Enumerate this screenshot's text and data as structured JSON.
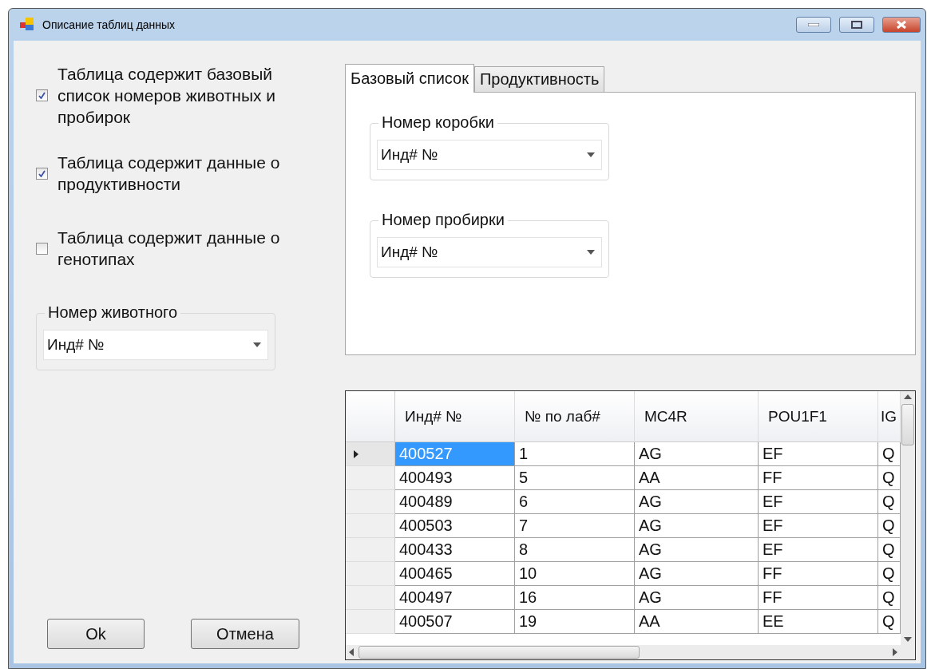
{
  "window": {
    "title": "Описание таблиц данных"
  },
  "checkboxes": [
    {
      "label": "Таблица содержит базовый список номеров животных и пробирок",
      "checked": true
    },
    {
      "label": "Таблица содержит данные о продуктивности",
      "checked": true
    },
    {
      "label": "Таблица содержит данные о генотипах",
      "checked": false
    }
  ],
  "animal_number": {
    "label": "Номер животного",
    "value": "Инд# №"
  },
  "tabs": [
    {
      "label": "Базовый список",
      "selected": true
    },
    {
      "label": "Продуктивность",
      "selected": false
    }
  ],
  "tab_groups": [
    {
      "label": "Номер коробки",
      "value": "Инд# №"
    },
    {
      "label": "Номер пробирки",
      "value": "Инд# №"
    }
  ],
  "grid": {
    "columns": [
      "Инд# №",
      "№ по лаб#",
      "MC4R",
      "POU1F1",
      "IG"
    ],
    "rows": [
      {
        "selected": true,
        "cells": [
          "400527",
          "1",
          "AG",
          "EF",
          "Q"
        ]
      },
      {
        "selected": false,
        "cells": [
          "400493",
          "5",
          "AA",
          "FF",
          "Q"
        ]
      },
      {
        "selected": false,
        "cells": [
          "400489",
          "6",
          "AG",
          "EF",
          "Q"
        ]
      },
      {
        "selected": false,
        "cells": [
          "400503",
          "7",
          "AG",
          "EF",
          "Q"
        ]
      },
      {
        "selected": false,
        "cells": [
          "400433",
          "8",
          "AG",
          "EF",
          "Q"
        ]
      },
      {
        "selected": false,
        "cells": [
          "400465",
          "10",
          "AG",
          "FF",
          "Q"
        ]
      },
      {
        "selected": false,
        "cells": [
          "400497",
          "16",
          "AG",
          "FF",
          "Q"
        ]
      },
      {
        "selected": false,
        "cells": [
          "400507",
          "19",
          "AA",
          "EE",
          "Q"
        ]
      }
    ]
  },
  "buttons": [
    "Ok",
    "Отмена"
  ]
}
